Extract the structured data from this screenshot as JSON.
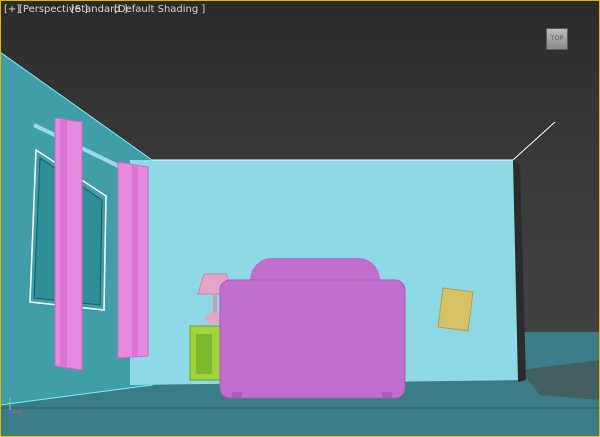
{
  "viewport": {
    "labels": {
      "plus": "[+]",
      "perspective": "[Perspective ]",
      "standard": "[Standard ]",
      "shading": "[Default Shading ]"
    },
    "viewcube_text": "TOP"
  },
  "colors": {
    "border_accent": "#e8b400",
    "wall_back": "#8ed9e6",
    "wall_side": "#3f9ea8",
    "floor": "#3a7d86",
    "curtain": "#e68ae0",
    "sofa": "#c26ecf",
    "nightstand": "#9fd43c",
    "lamp": "#e7a5c6",
    "note": "#d6c264"
  }
}
